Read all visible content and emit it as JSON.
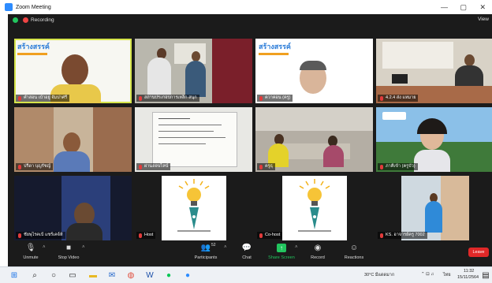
{
  "window": {
    "title": "Zoom Meeting",
    "controls": [
      "—",
      "▢",
      "✕"
    ]
  },
  "status": {
    "recording": "Recording",
    "view": "View"
  },
  "tiles": [
    {
      "name": "คำสอน เบ้าอยู่ จัมปาศรี",
      "logo": "สร้างสรรค์"
    },
    {
      "name": "สถานประกอบการเหล็ก สนุก"
    },
    {
      "name": "ควาคอน (ครู)",
      "logo": "สร้างสรรค์"
    },
    {
      "name": "4.2.4 ส่ง แหมาย"
    },
    {
      "name": "ปรีดา บุญรัชญ์"
    },
    {
      "name": "ผ่านออนไลน์"
    },
    {
      "name": "ครูธุ"
    },
    {
      "name": "ภาคีเข้า (ครูบัว)"
    },
    {
      "name": "ชัยพุไรคเป้ แชร์เคจ์ห้"
    },
    {
      "name": "Host"
    },
    {
      "name": "Co-host"
    },
    {
      "name": "KS. อาจารย์ครู 7002"
    }
  ],
  "toolbar": {
    "unmute": "Unmute",
    "stop_video": "Stop Video",
    "participants": "Participants",
    "participant_count": "52",
    "chat": "Chat",
    "share_screen": "Share Screen",
    "record": "Record",
    "reactions": "Reactions",
    "leave": "Leave"
  },
  "taskbar": {
    "weather": "30°C มีแดดมาก",
    "lang": "ไทย",
    "time": "11:32",
    "date": "15/11/2564"
  },
  "colors": {
    "accent": "#2d8cff",
    "active_border": "#d6e44a",
    "share": "#22c55e",
    "leave": "#e02828"
  }
}
